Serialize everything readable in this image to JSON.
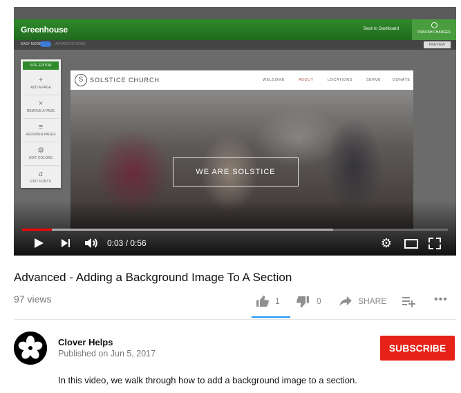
{
  "player": {
    "embedded_app": {
      "brand": "Greenhouse",
      "back_link": "Back to Dashboard",
      "publish_label": "PUBLISH CHANGES",
      "easy_mode": "EASY MODE",
      "advanced_mode": "ADVANCED MODE",
      "preview": "PREVIEW",
      "site_editor": {
        "title": "SITE EDITOR",
        "items": [
          {
            "glyph": "+",
            "label": "ADD A PAGE",
            "icon": "plus-icon"
          },
          {
            "glyph": "×",
            "label": "REMOVE A PAGE",
            "icon": "x-icon"
          },
          {
            "glyph": "≡",
            "label": "REORDER PAGES",
            "icon": "reorder-icon"
          },
          {
            "glyph": "⚙",
            "label": "EDIT COLORS",
            "icon": "gear-icon"
          },
          {
            "glyph": "a",
            "label": "EDIT FONTS",
            "icon": "font-icon"
          }
        ]
      },
      "site": {
        "logo_mark": "S",
        "logo_text": "SOLSTICE CHURCH",
        "nav": [
          "WELCOME",
          "ABOUT",
          "LOCATIONS",
          "SERVE",
          "DONATE"
        ],
        "active_nav": "ABOUT",
        "active_color": "#b0614a",
        "hero_text": "WE ARE SOLSTICE"
      }
    },
    "time_current": "0:03",
    "time_total": "0:56",
    "time_display": "0:03 / 0:56",
    "progress_played_fraction": 0.07,
    "progress_loaded_fraction": 0.73,
    "progress_color": "#ff0000"
  },
  "video": {
    "title": "Advanced - Adding a Background Image To A Section",
    "views": "97 views",
    "likes": "1",
    "dislikes": "0",
    "share_label": "SHARE",
    "accent_color": "#2196f3"
  },
  "channel": {
    "name": "Clover Helps",
    "published": "Published on Jun 5, 2017",
    "subscribe_label": "SUBSCRIBE",
    "subscribe_color": "#e62117"
  },
  "description": "In this video, we walk through how to add a background image to a section."
}
